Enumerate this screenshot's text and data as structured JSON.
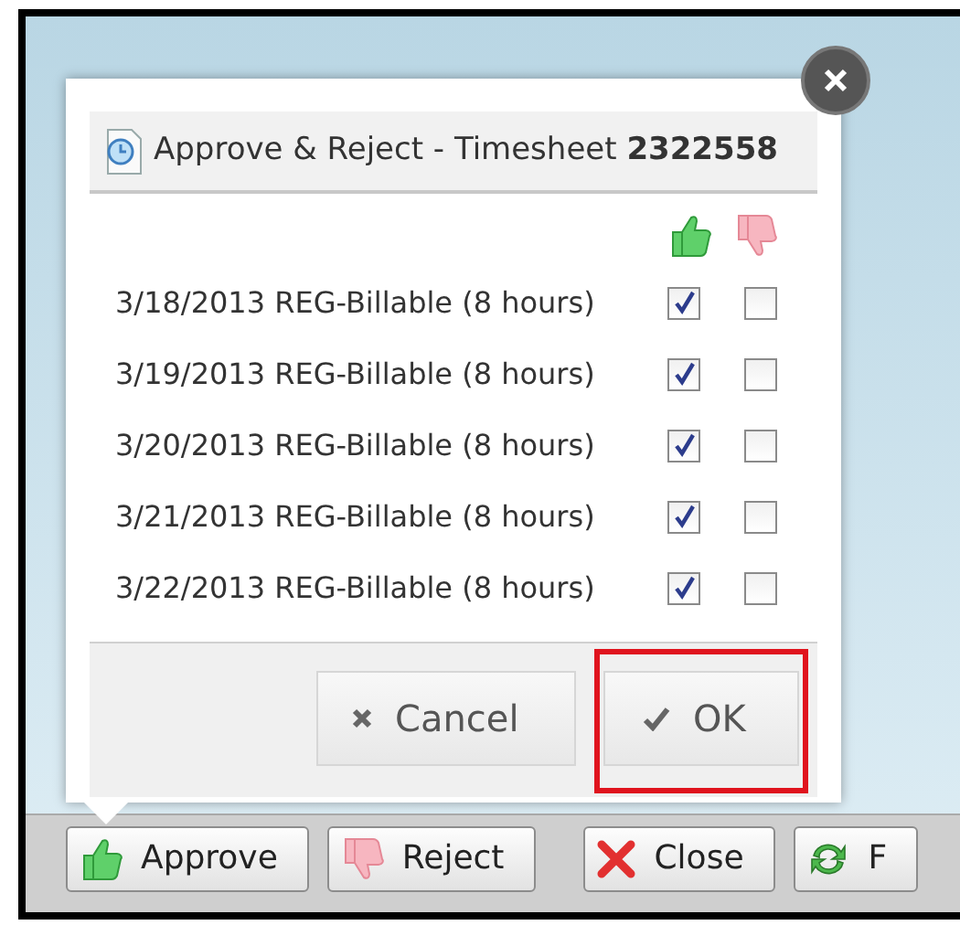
{
  "dialog": {
    "title": "Approve & Reject - Timesheet ",
    "title_number": "2322558",
    "entries": [
      {
        "label": "3/18/2013 REG-Billable (8 hours)",
        "approve": true,
        "reject": false
      },
      {
        "label": "3/19/2013 REG-Billable (8 hours)",
        "approve": true,
        "reject": false
      },
      {
        "label": "3/20/2013 REG-Billable (8 hours)",
        "approve": true,
        "reject": false
      },
      {
        "label": "3/21/2013 REG-Billable (8 hours)",
        "approve": true,
        "reject": false
      },
      {
        "label": "3/22/2013 REG-Billable (8 hours)",
        "approve": true,
        "reject": false
      }
    ],
    "buttons": [
      {
        "label": "Cancel",
        "kind": "cancel",
        "highlighted": false
      },
      {
        "label": "OK",
        "kind": "ok",
        "highlighted": true
      }
    ]
  },
  "toolbar": [
    {
      "label": "Approve",
      "kind": "approve"
    },
    {
      "label": "Reject",
      "kind": "reject"
    },
    {
      "label": "Close",
      "kind": "close"
    },
    {
      "label": "F",
      "kind": "refresh"
    }
  ]
}
